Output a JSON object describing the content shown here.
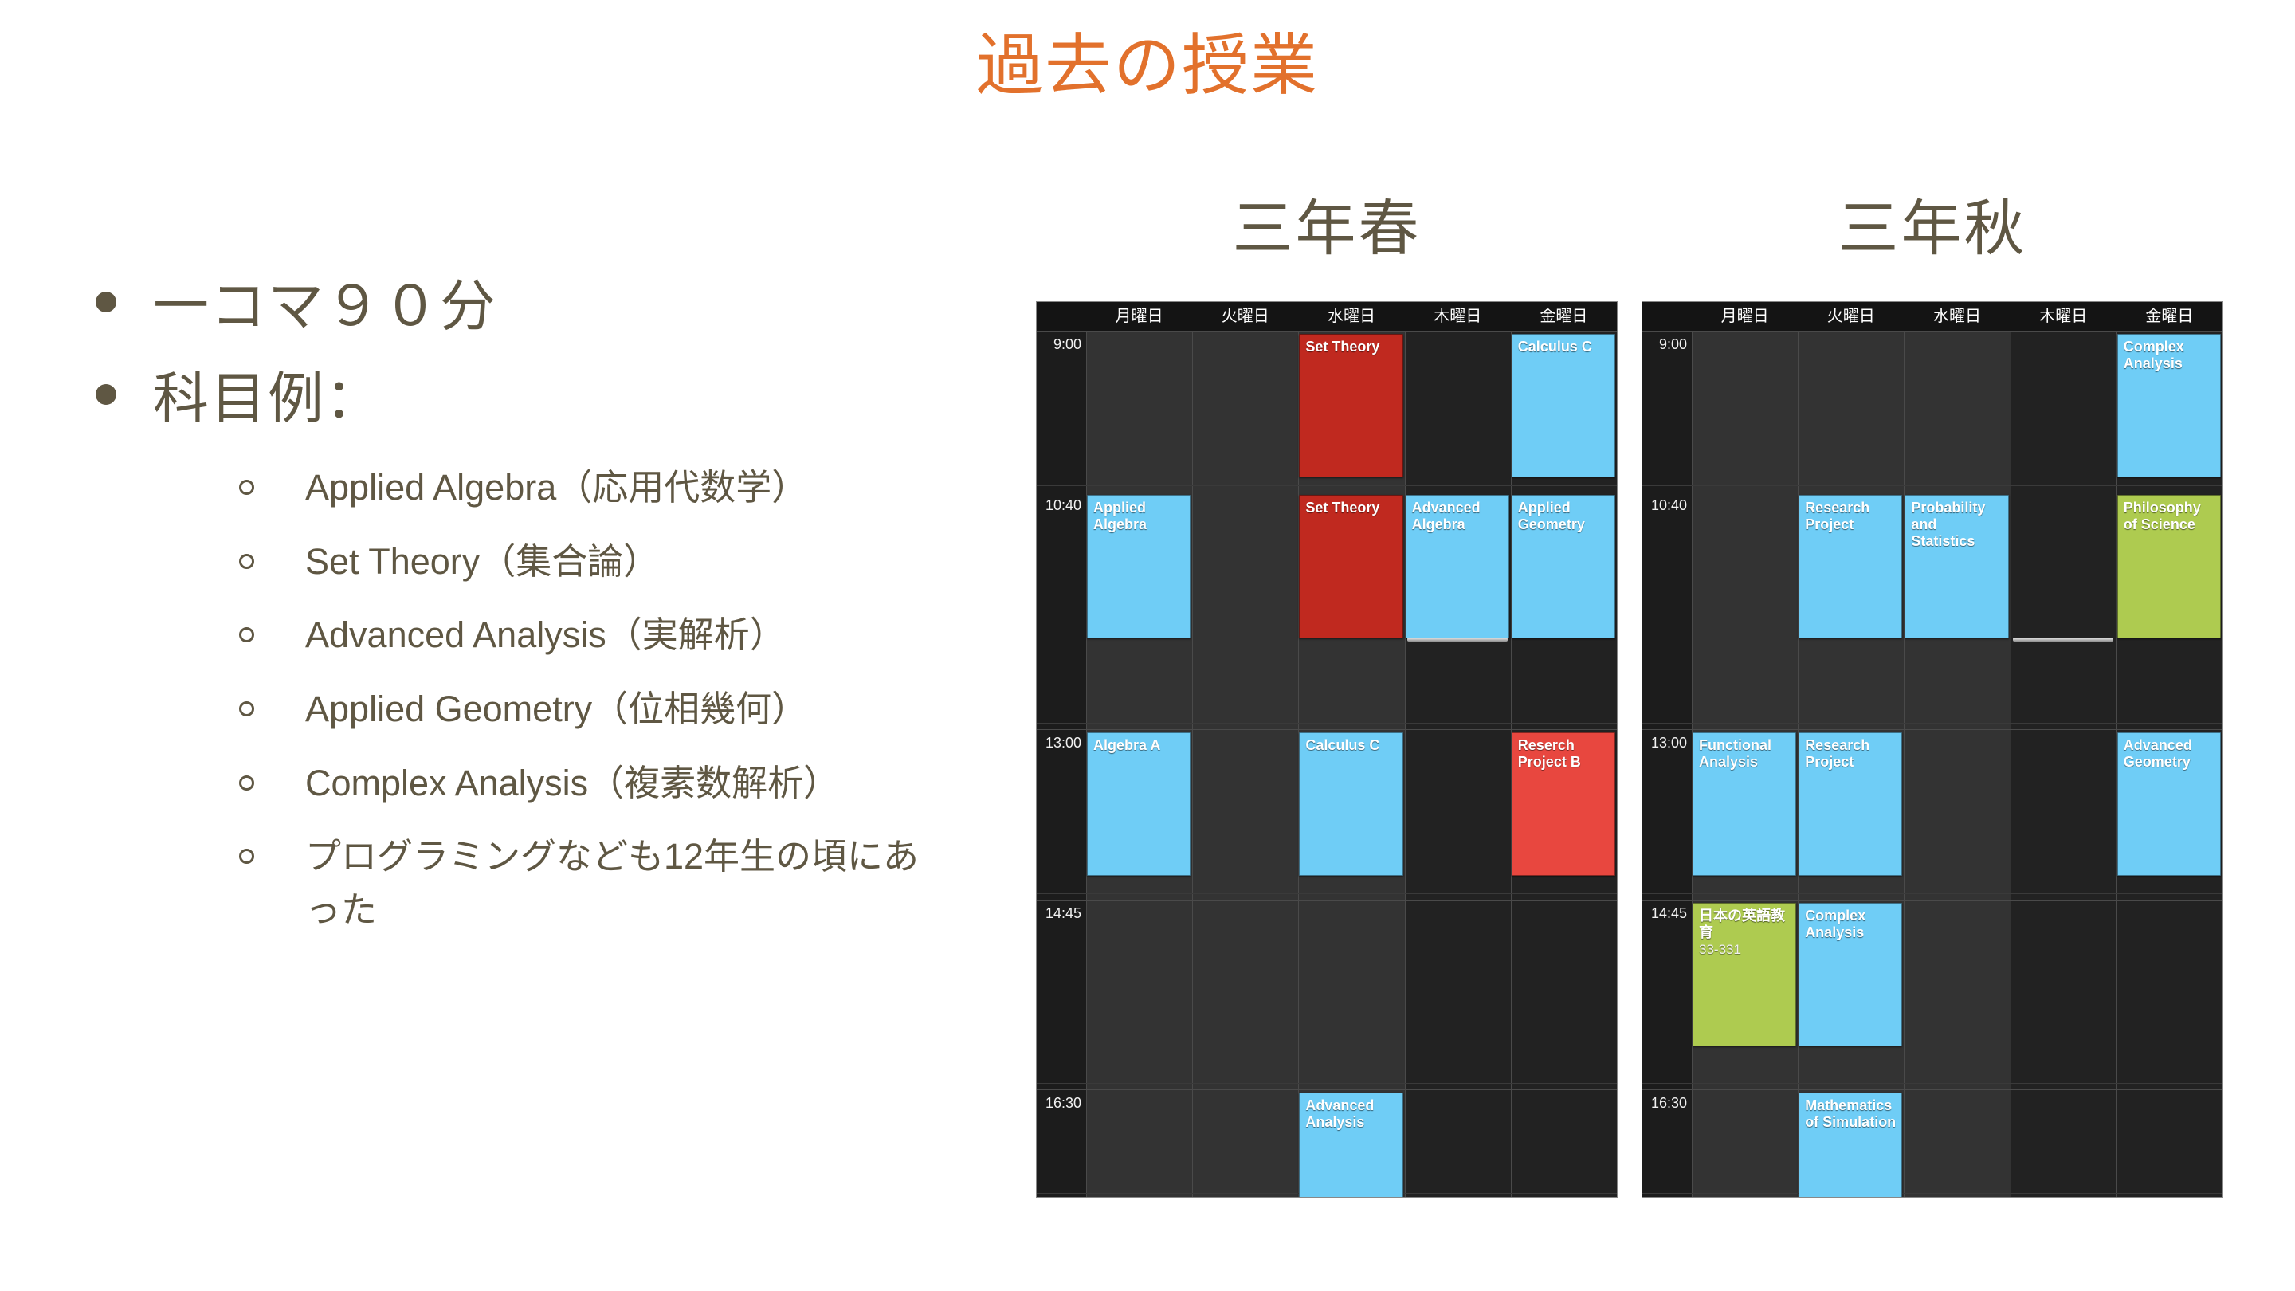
{
  "slide": {
    "title": "過去の授業",
    "title_color": "#e2712c",
    "body_color": "#5f5743"
  },
  "bullets": [
    {
      "text": "一コマ９０分"
    },
    {
      "text": "科目例："
    }
  ],
  "sub_bullets": [
    {
      "text": "Applied Algebra（応用代数学）"
    },
    {
      "text": "Set Theory（集合論）"
    },
    {
      "text": "Advanced Analysis（実解析）"
    },
    {
      "text": "Applied Geometry（位相幾何）"
    },
    {
      "text": "Complex Analysis（複素数解析）"
    },
    {
      "text": "プログラミングなども12年生の頃にあった"
    }
  ],
  "calendars": [
    {
      "id": "spring",
      "title": "三年春",
      "days": [
        "月曜日",
        "火曜日",
        "水曜日",
        "木曜日",
        "金曜日"
      ],
      "times": [
        "9:00",
        "10:40",
        "13:00",
        "14:45",
        "16:30"
      ],
      "events": [
        {
          "title": "Set Theory",
          "day": 2,
          "slot": 0,
          "color": "ev-darkred"
        },
        {
          "title": "Calculus C",
          "day": 4,
          "slot": 0,
          "color": "ev-blue"
        },
        {
          "title": "Applied Algebra",
          "day": 0,
          "slot": 1,
          "color": "ev-blue"
        },
        {
          "title": "Set Theory",
          "day": 2,
          "slot": 1,
          "color": "ev-darkred"
        },
        {
          "title": "Advanced Algebra",
          "day": 3,
          "slot": 1,
          "color": "ev-blue"
        },
        {
          "title": "Applied Geometry",
          "day": 4,
          "slot": 1,
          "color": "ev-blue"
        },
        {
          "title": "Algebra A",
          "day": 0,
          "slot": 2,
          "color": "ev-blue"
        },
        {
          "title": "Calculus C",
          "day": 2,
          "slot": 2,
          "color": "ev-blue"
        },
        {
          "title": "Reserch Project B",
          "day": 4,
          "slot": 2,
          "color": "ev-red"
        },
        {
          "title": "Advanced Analysis",
          "day": 2,
          "slot": 4,
          "color": "ev-blue"
        }
      ]
    },
    {
      "id": "fall",
      "title": "三年秋",
      "days": [
        "月曜日",
        "火曜日",
        "水曜日",
        "木曜日",
        "金曜日"
      ],
      "times": [
        "9:00",
        "10:40",
        "13:00",
        "14:45",
        "16:30"
      ],
      "events": [
        {
          "title": "Complex Analysis",
          "day": 4,
          "slot": 0,
          "color": "ev-blue"
        },
        {
          "title": "Research Project",
          "day": 1,
          "slot": 1,
          "color": "ev-blue"
        },
        {
          "title": "Probability and Statistics",
          "day": 2,
          "slot": 1,
          "color": "ev-blue"
        },
        {
          "title": "Philosophy of Science",
          "day": 4,
          "slot": 1,
          "color": "ev-green"
        },
        {
          "title": "Functional Analysis",
          "day": 0,
          "slot": 2,
          "color": "ev-blue"
        },
        {
          "title": "Research Project",
          "day": 1,
          "slot": 2,
          "color": "ev-blue"
        },
        {
          "title": "Advanced Geometry",
          "day": 4,
          "slot": 2,
          "color": "ev-blue"
        },
        {
          "title": "日本の英語教育",
          "room": "33-331",
          "day": 0,
          "slot": 3,
          "color": "ev-green"
        },
        {
          "title": "Complex Analysis",
          "day": 1,
          "slot": 3,
          "color": "ev-blue"
        },
        {
          "title": "Mathematics of Simulation",
          "day": 1,
          "slot": 4,
          "color": "ev-blue"
        }
      ]
    }
  ],
  "colors": {
    "blue": "#6fcdf6",
    "dark_red": "#c0291f",
    "red": "#e8473f",
    "green": "#aecb50",
    "calendar_bg": "#222222"
  }
}
